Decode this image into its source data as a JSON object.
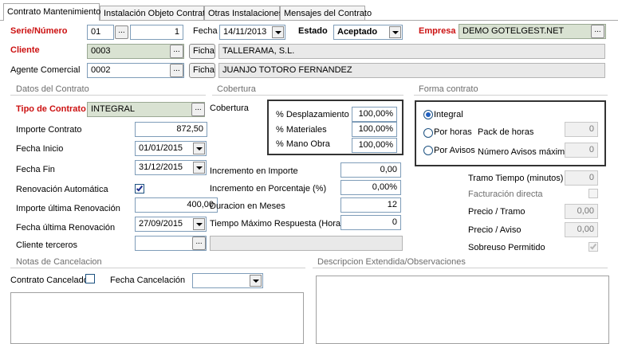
{
  "tabs": [
    {
      "label": "Contrato Mantenimiento"
    },
    {
      "label": "Instalación Objeto Contrato"
    },
    {
      "label": "Otras Instalaciones"
    },
    {
      "label": "Mensajes del Contrato"
    }
  ],
  "header": {
    "serie_label": "Serie/Número",
    "serie_value": "01",
    "numero_value": "1",
    "fecha_label": "Fecha",
    "fecha_value": "14/11/2013",
    "estado_label": "Estado",
    "estado_value": "Aceptado",
    "empresa_label": "Empresa",
    "empresa_value": "DEMO GOTELGEST.NET",
    "cliente_label": "Cliente",
    "cliente_code": "0003",
    "cliente_name": "TALLERAMA, S.L.",
    "agente_label": "Agente Comercial",
    "agente_code": "0002",
    "agente_name": "JUANJO TOTORO FERNANDEZ",
    "ficha_label": "Ficha",
    "dots": "..."
  },
  "datos": {
    "section_title": "Datos del Contrato",
    "tipo_label": "Tipo de Contrato",
    "tipo_value": "INTEGRAL",
    "importe_label": "Importe Contrato",
    "importe_value": "872,50",
    "fecha_inicio_label": "Fecha Inicio",
    "fecha_inicio_value": "01/01/2015",
    "fecha_fin_label": "Fecha Fin",
    "fecha_fin_value": "31/12/2015",
    "renovacion_label": "Renovación Automática",
    "renovacion_checked": true,
    "importe_renov_label": "Importe última Renovación",
    "importe_renov_value": "400,00",
    "fecha_renov_label": "Fecha última Renovación",
    "fecha_renov_value": "27/09/2015",
    "cliente_terceros_label": "Cliente terceros",
    "cliente_terceros_value": ""
  },
  "cobertura": {
    "section_title": "Cobertura",
    "label": "Cobertura",
    "desplazamiento_label": "% Desplazamiento",
    "desplazamiento_value": "100,00%",
    "materiales_label": "% Materiales",
    "materiales_value": "100,00%",
    "mano_obra_label": "% Mano Obra",
    "mano_obra_value": "100,00%",
    "inc_importe_label": "Incremento en Importe",
    "inc_importe_value": "0,00",
    "inc_pct_label": "Incremento en Porcentaje (%)",
    "inc_pct_value": "0,00%",
    "duracion_label": "Duracion en Meses",
    "duracion_value": "12",
    "tiempo_label": "Tiempo Máximo Respuesta (Horas)",
    "tiempo_value": "0"
  },
  "forma": {
    "section_title": "Forma contrato",
    "integral_label": "Integral",
    "por_horas_label": "Por horas",
    "por_avisos_label": "Por Avisos",
    "selected": "Integral",
    "pack_label": "Pack de horas",
    "pack_value": "0",
    "num_avisos_label": "Número Avisos máximo",
    "num_avisos_value": "0",
    "tramo_label": "Tramo Tiempo (minutos)",
    "tramo_value": "0",
    "facturacion_label": "Facturación directa",
    "facturacion_checked": false,
    "precio_tramo_label": "Precio / Tramo",
    "precio_tramo_value": "0,00",
    "precio_aviso_label": "Precio / Aviso",
    "precio_aviso_value": "0,00",
    "sobreuso_label": "Sobreuso Permitido",
    "sobreuso_checked": true
  },
  "notas": {
    "section_title": "Notas de Cancelacion",
    "cancelado_label": "Contrato Cancelado",
    "fecha_cancel_label": "Fecha Cancelación",
    "fecha_cancel_value": "",
    "text": ""
  },
  "descripcion": {
    "section_title": "Descripcion Extendida/Observaciones",
    "text": ""
  },
  "colors": {
    "required_label": "#cc1111",
    "readonly_green": "#d9e2d2",
    "field_border": "#7f9db9"
  }
}
